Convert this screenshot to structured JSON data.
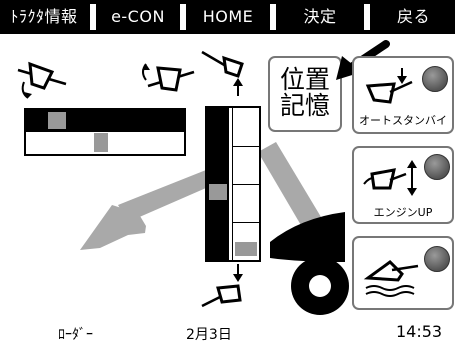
{
  "topbar": {
    "tabs": [
      {
        "label": "ﾄﾗｸﾀ情報"
      },
      {
        "label": "e-CON"
      },
      {
        "label": "HOME"
      },
      {
        "label": "決定"
      },
      {
        "label": "戻る"
      }
    ]
  },
  "buttons": {
    "memory": {
      "label_line1": "位置",
      "label_line2": "記憶"
    },
    "auto_standby": {
      "label": "オートスタンバイ",
      "icon": "bucket-down-arrow-icon"
    },
    "engine_up": {
      "label": "エンジンUP",
      "icon": "bucket-tilt-updown-icon"
    },
    "float": {
      "icon": "bucket-float-icon"
    }
  },
  "gauges": {
    "horizontal_upper_indicator": 0.3,
    "horizontal_lower_indicator": 0.47,
    "vertical_left_indicator": 0.57,
    "vertical_right_indicator": 0.93
  },
  "statusbar": {
    "mode": "ﾛｰﾀﾞｰ",
    "date": "2月3日",
    "time": "14:53"
  },
  "colors": {
    "topbar": "#000000",
    "loader_arm": "#a9a9a9",
    "lamp": "#666666"
  }
}
